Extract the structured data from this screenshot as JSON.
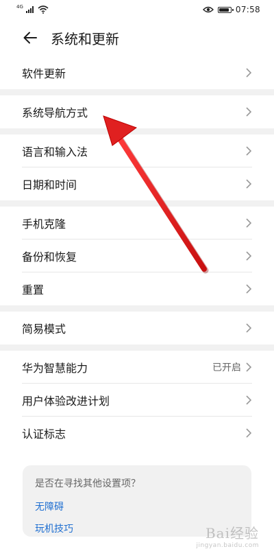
{
  "status_bar": {
    "network": "4G",
    "time": "07:58",
    "battery_level": 0.9
  },
  "header": {
    "title": "系统和更新"
  },
  "groups": [
    {
      "items": [
        {
          "label": "软件更新",
          "status": ""
        }
      ]
    },
    {
      "items": [
        {
          "label": "系统导航方式",
          "status": ""
        }
      ]
    },
    {
      "items": [
        {
          "label": "语言和输入法",
          "status": ""
        },
        {
          "label": "日期和时间",
          "status": ""
        }
      ]
    },
    {
      "items": [
        {
          "label": "手机克隆",
          "status": ""
        },
        {
          "label": "备份和恢复",
          "status": ""
        },
        {
          "label": "重置",
          "status": ""
        }
      ]
    },
    {
      "items": [
        {
          "label": "简易模式",
          "status": ""
        }
      ]
    },
    {
      "items": [
        {
          "label": "华为智慧能力",
          "status": "已开启"
        },
        {
          "label": "用户体验改进计划",
          "status": ""
        },
        {
          "label": "认证标志",
          "status": ""
        }
      ]
    }
  ],
  "help_card": {
    "title": "是否在寻找其他设置项？",
    "links": [
      "无障碍",
      "玩机技巧"
    ]
  },
  "watermark": {
    "logo": "Bai经验",
    "url": "jingyan.baidu.com"
  },
  "colors": {
    "link": "#1f6fd1",
    "annotation_arrow": "#e02020",
    "section_gap": "#f1f1f1"
  },
  "icons": {
    "back": "arrow-left-icon",
    "chevron": "chevron-right-icon",
    "eye": "eye-comfort-icon",
    "wifi": "wifi-icon",
    "signal": "cellular-signal-icon",
    "battery": "battery-icon"
  }
}
